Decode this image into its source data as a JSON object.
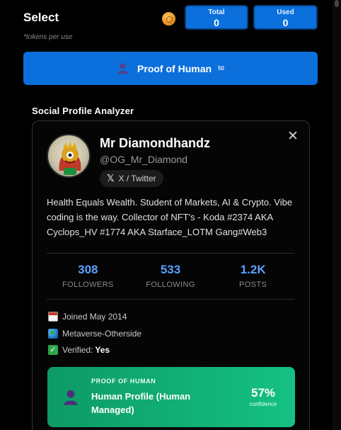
{
  "header": {
    "title": "Select",
    "tokens_note": "*tokens per use",
    "coin_icon": "coin-icon",
    "total_label": "Total",
    "total_value": "0",
    "used_label": "Used",
    "used_value": "0"
  },
  "poh_button": {
    "label": "Proof of Human",
    "cost": "50",
    "icon": "person-icon",
    "color": "#0b6fdc"
  },
  "analyzer": {
    "heading": "Social Profile Analyzer"
  },
  "profile": {
    "name": "Mr Diamondhandz",
    "handle": "@OG_Mr_Diamond",
    "platform": "X / Twitter",
    "platform_glyph": "𝕏",
    "close_glyph": "✕",
    "bio": "Health Equals Wealth. Student of Markets, AI & Crypto. Vibe coding is the way. Collector of NFT's - Koda #2374 AKA Cyclops_HV #1774 AKA Starface_LOTM Gang#Web3",
    "stats": {
      "followers_value": "308",
      "followers_label": "FOLLOWERS",
      "following_value": "533",
      "following_label": "FOLLOWING",
      "posts_value": "1.2K",
      "posts_label": "POSTS"
    },
    "joined": "Joined May 2014",
    "location": "Metaverse-Otherside",
    "verified_label": "Verified:",
    "verified_value": "Yes"
  },
  "poh_result": {
    "kicker": "PROOF OF HUMAN",
    "result": "Human Profile (Human Managed)",
    "confidence_value": "57%",
    "confidence_label": "confidence",
    "color": "#15c183"
  },
  "colors": {
    "accent_blue": "#0b6fdc",
    "stat_blue": "#5aa0ff",
    "success_green": "#15c183"
  }
}
